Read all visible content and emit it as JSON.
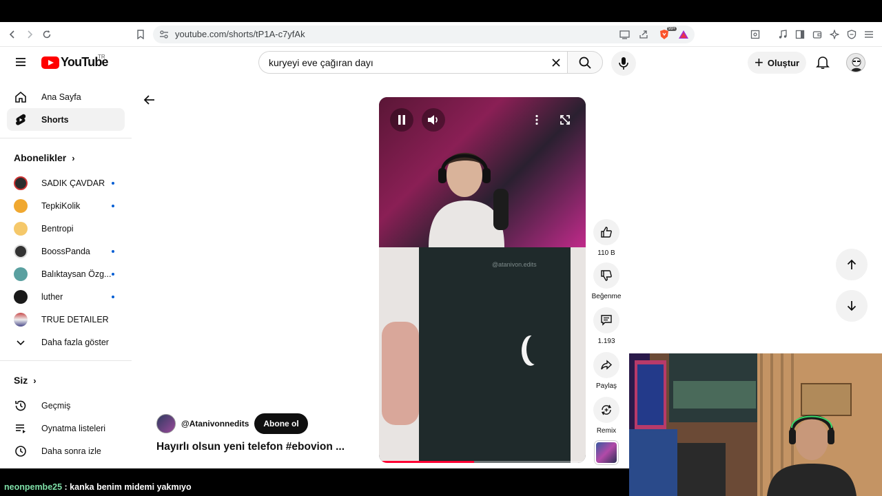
{
  "browser": {
    "url": "youtube.com/shorts/tP1A-c7yfAk",
    "brave_badge": "99+"
  },
  "header": {
    "logo_text": "YouTube",
    "country_code": "TR",
    "search_query": "kuryeyi eve çağıran dayı",
    "create_label": "Oluştur"
  },
  "sidebar": {
    "main": [
      {
        "label": "Ana Sayfa",
        "icon": "home-icon"
      },
      {
        "label": "Shorts",
        "icon": "shorts-icon"
      }
    ],
    "subscriptions_title": "Abonelikler",
    "subscriptions": [
      {
        "label": "SADIK ÇAVDAR",
        "color": "#2b2b2b",
        "new": true
      },
      {
        "label": "TepkiKolik",
        "color": "#f0a830",
        "new": true
      },
      {
        "label": "Bentropi",
        "color": "#f5c86a",
        "new": false
      },
      {
        "label": "BoossPanda",
        "color": "#333333",
        "new": true
      },
      {
        "label": "Balıktaysan Özg...",
        "color": "#5aa0a0",
        "new": true
      },
      {
        "label": "luther",
        "color": "#1a1a1a",
        "new": true
      },
      {
        "label": "TRUE DETAILER",
        "color": "#c84a4a",
        "new": false
      }
    ],
    "show_more": "Daha fazla göster",
    "you_title": "Siz",
    "you_items": [
      {
        "label": "Geçmiş",
        "icon": "history-icon"
      },
      {
        "label": "Oynatma listeleri",
        "icon": "playlists-icon"
      },
      {
        "label": "Daha sonra izle",
        "icon": "watch-later-icon"
      }
    ]
  },
  "video": {
    "watermark": "@atanivon.edits",
    "progress": 0.46
  },
  "actions": {
    "like_count": "110 B",
    "dislike_label": "Beğenme",
    "comment_count": "1.193",
    "share_label": "Paylaş",
    "remix_label": "Remix"
  },
  "channel": {
    "name": "@Atanivonnedits",
    "subscribe_label": "Abone ol",
    "title": "Hayırlı olsun yeni telefon #ebovion ..."
  },
  "chat": {
    "user": "neonpembe25",
    "message": " : kanka benim midemi yakmıyo"
  }
}
